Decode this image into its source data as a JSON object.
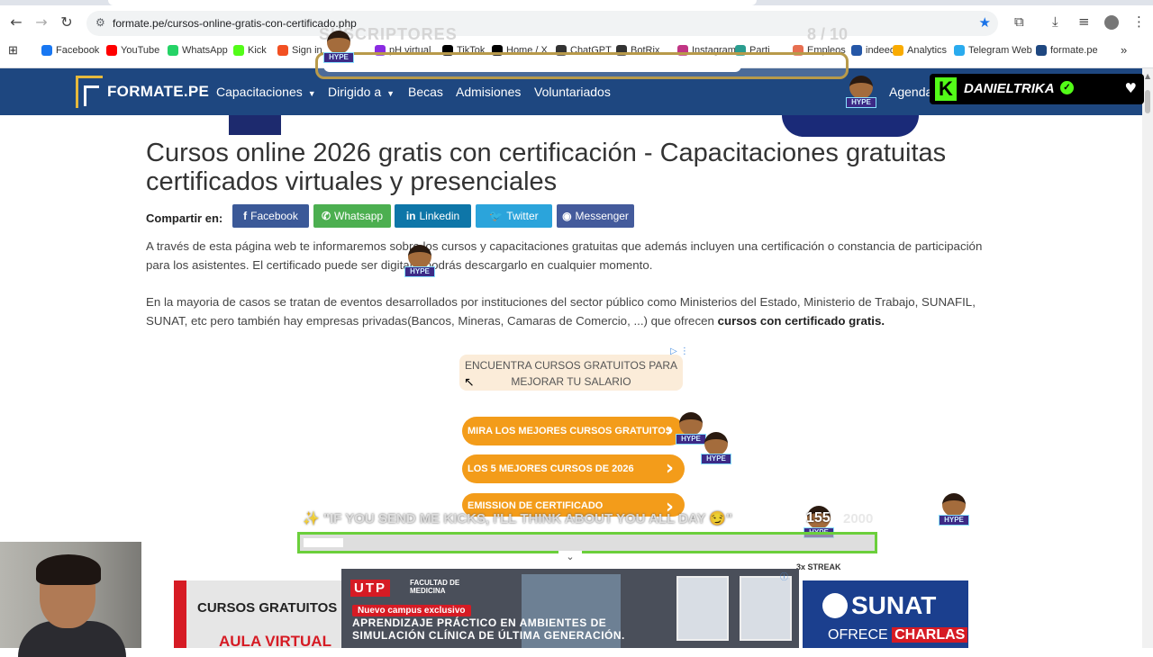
{
  "browser": {
    "url": "formate.pe/cursos-online-gratis-con-certificado.php",
    "bookmarks": [
      {
        "label": "Facebook",
        "icon": "facebook-icon",
        "color": "#1877f2"
      },
      {
        "label": "YouTube",
        "icon": "youtube-icon",
        "color": "#ff0000"
      },
      {
        "label": "WhatsApp",
        "icon": "whatsapp-icon",
        "color": "#25d366"
      },
      {
        "label": "Kick",
        "icon": "kick-icon",
        "color": "#53fc18"
      },
      {
        "label": "Sign in",
        "icon": "microsoft-icon",
        "color": "#f25022"
      },
      {
        "label": "pH virtual",
        "icon": "bookmark-icon",
        "color": "#8a2be2"
      },
      {
        "label": "TikTok",
        "icon": "tiktok-icon",
        "color": "#000000"
      },
      {
        "label": "Home / X",
        "icon": "x-icon",
        "color": "#000000"
      },
      {
        "label": "ChatGPT",
        "icon": "chatgpt-icon",
        "color": "#333333"
      },
      {
        "label": "BotRix",
        "icon": "botrix-icon",
        "color": "#333333"
      },
      {
        "label": "Instagram",
        "icon": "instagram-icon",
        "color": "#c13584"
      },
      {
        "label": "Parti",
        "icon": "parti-icon",
        "color": "#2a9d8f"
      },
      {
        "label": "Empleos",
        "icon": "empleos-icon",
        "color": "#e76f51"
      },
      {
        "label": "indeed",
        "icon": "indeed-icon",
        "color": "#2557a7"
      },
      {
        "label": "Analytics",
        "icon": "analytics-icon",
        "color": "#f9ab00"
      },
      {
        "label": "Telegram Web",
        "icon": "telegram-icon",
        "color": "#2aabee"
      },
      {
        "label": "formate.pe",
        "icon": "formate-icon",
        "color": "#1e4780"
      }
    ]
  },
  "site": {
    "logo": "FORMATE.PE",
    "nav": [
      {
        "label": "Capacitaciones",
        "caret": "▼"
      },
      {
        "label": "Dirigido a",
        "caret": "▼"
      },
      {
        "label": "Becas",
        "caret": ""
      },
      {
        "label": "Admisiones",
        "caret": ""
      },
      {
        "label": "Voluntariados",
        "caret": ""
      }
    ],
    "agenda": "Agenda",
    "brand_color": "#1e4780"
  },
  "content": {
    "title": "Cursos online 2026 gratis con certificación - Capacitaciones gratuitas certificados virtuales y presenciales",
    "share_label": "Compartir en:",
    "share_buttons": [
      {
        "label": "Facebook",
        "icon": "f",
        "color": "#3b5998"
      },
      {
        "label": "Whatsapp",
        "icon": "✆",
        "color": "#4caf50"
      },
      {
        "label": "Linkedin",
        "icon": "in",
        "color": "#0e76a8"
      },
      {
        "label": "Twitter",
        "icon": "🐦",
        "color": "#2ba4db"
      },
      {
        "label": "Messenger",
        "icon": "◉",
        "color": "#445b9c"
      }
    ],
    "para1": "A través de esta página web te informaremos sobre los cursos y capacitaciones gratuitas que además incluyen una certificación o constancia de participación para los asistentes. El certificado puede ser digital y podrás descargarlo en cualquier momento.",
    "para2_start": "En la mayoria de casos se tratan de eventos desarrollados por instituciones del sector público como Ministerios del Estado, Ministerio de Trabajo, SUNAFIL, SUNAT, etc pero también hay empresas privadas(Bancos, Mineras, Camaras de Comercio, ...) que ofrecen ",
    "para2_bold": "cursos con certificado gratis."
  },
  "ad": {
    "headline": "ENCUENTRA CURSOS GRATUITOS PARA MEJORAR TU SALARIO",
    "pills": [
      "MIRA LOS MEJORES CURSOS GRATUITOS",
      "LOS 5 MEJORES CURSOS DE 2026",
      "EMISSION DE CERTIFICADO"
    ],
    "accent": "#f39c1a"
  },
  "overlay": {
    "subs_label": "SUSCRIPTORES",
    "subs_count": "8 / 10",
    "subs_progress": 0.8,
    "username": "DANIELTRIKA",
    "message": "\"IF YOU SEND ME KICKS, I'LL THINK ABOUT YOU ALL DAY 😏\"",
    "kicks_count": "155",
    "kicks_goal": "2000",
    "streak": "3x STREAK",
    "avatar_tag": "HYPE"
  },
  "bottom_ads": {
    "left_title": "CURSOS GRATUITOS",
    "left_sub": "AULA VIRTUAL",
    "utp_logo": "UTP",
    "utp_faculty": "FACULTAD DE MEDICINA",
    "utp_badge": "Nuevo campus exclusivo",
    "utp_line1": "APRENDIZAJE PRÁCTICO EN AMBIENTES DE",
    "utp_line2": "SIMULACIÓN CLÍNICA DE ÚLTIMA GENERACIÓN.",
    "sunat": "SUNAT",
    "sunat_offer": "OFRECE",
    "sunat_offer_bold": "CHARLAS"
  }
}
